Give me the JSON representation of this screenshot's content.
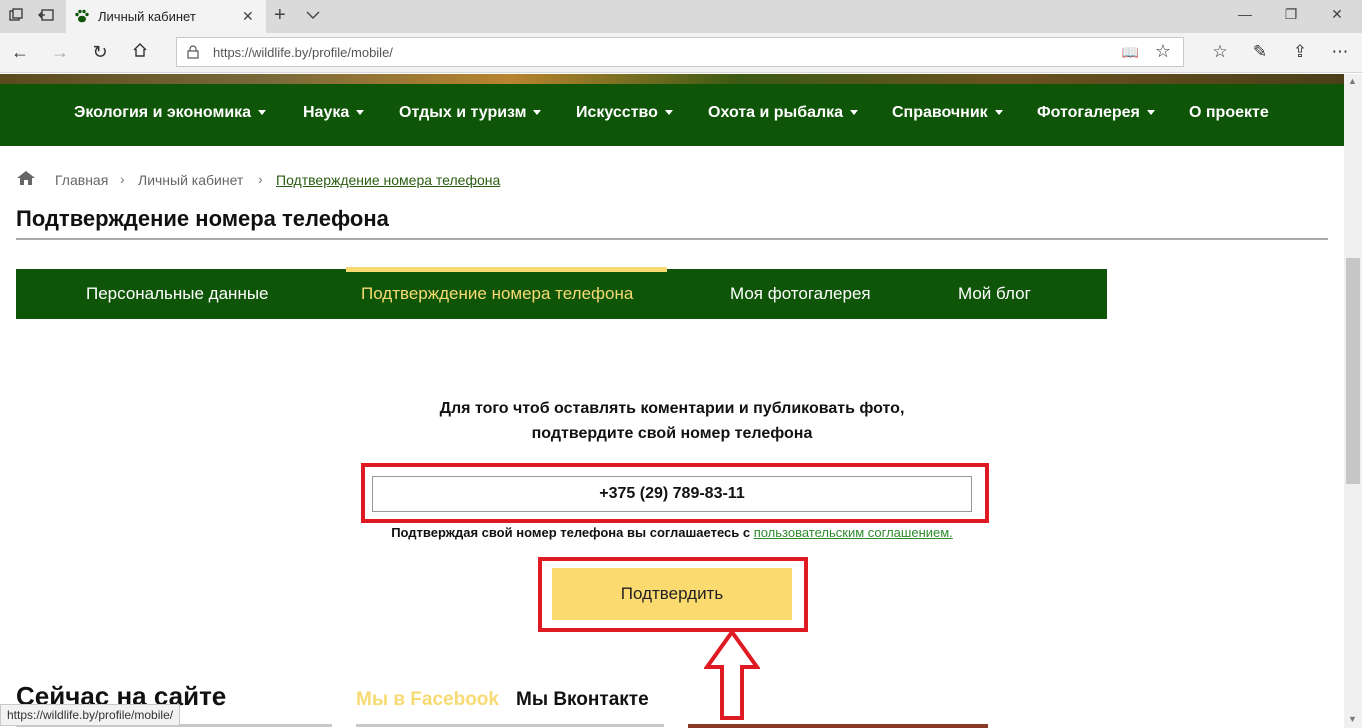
{
  "browser": {
    "tab_title": "Личный кабинет",
    "url": "https://wildlife.by/profile/mobile/",
    "icons": {
      "tab_actions": "tab-actions-icon",
      "set_aside": "set-aside-tabs-icon",
      "favicon": "paw-icon",
      "close_tab": "close-icon",
      "new_tab": "plus-icon",
      "tab_menu": "chevron-down-icon",
      "back": "arrow-left-icon",
      "forward": "arrow-right-icon",
      "refresh": "refresh-icon",
      "home": "home-icon",
      "lock": "lock-icon",
      "reading_view": "book-icon",
      "favorite": "star-icon",
      "favorites_list": "favorites-list-icon",
      "pen": "pen-icon",
      "share": "share-icon",
      "more": "ellipsis-icon"
    }
  },
  "main_nav": {
    "items": [
      {
        "label": "Экология и экономика",
        "has_dropdown": true
      },
      {
        "label": "Наука",
        "has_dropdown": true
      },
      {
        "label": "Отдых и туризм",
        "has_dropdown": true
      },
      {
        "label": "Искусство",
        "has_dropdown": true
      },
      {
        "label": "Охота и рыбалка",
        "has_dropdown": true
      },
      {
        "label": "Справочник",
        "has_dropdown": true
      },
      {
        "label": "Фотогалерея",
        "has_dropdown": true
      },
      {
        "label": "О проекте",
        "has_dropdown": false
      }
    ]
  },
  "breadcrumb": {
    "items": [
      "Главная",
      "Личный кабинет",
      "Подтверждение номера телефона"
    ]
  },
  "page_title": "Подтверждение номера телефона",
  "profile_tabs": {
    "items": [
      {
        "label": "Персональные данные"
      },
      {
        "label": "Подтверждение номера телефона",
        "active": true
      },
      {
        "label": "Моя фотогалерея"
      },
      {
        "label": "Мой блог"
      }
    ]
  },
  "form": {
    "intro_line1": "Для того чтоб оставлять коментарии и публиковать фото,",
    "intro_line2": "подтвердите свой номер телефона",
    "phone_value": "+375 (29) 789-83-11",
    "agreement_text": "Подтверждая свой номер телефона вы соглашаетесь с",
    "agreement_link": "пользовательским соглашением.",
    "confirm_label": "Подтвердить"
  },
  "bottom": {
    "section_title": "Сейчас на сайте",
    "facebook_tab": "Мы в Facebook",
    "vk_tab": "Мы Вконтакте"
  },
  "status_bar": {
    "url": "https://wildlife.by/profile/mobile/"
  },
  "colors": {
    "nav_green": "#0f5508",
    "accent_yellow": "#f7da72",
    "button_yellow": "#fbdb70",
    "highlight_red": "#e01a22",
    "link_green": "#2e8b2e"
  }
}
